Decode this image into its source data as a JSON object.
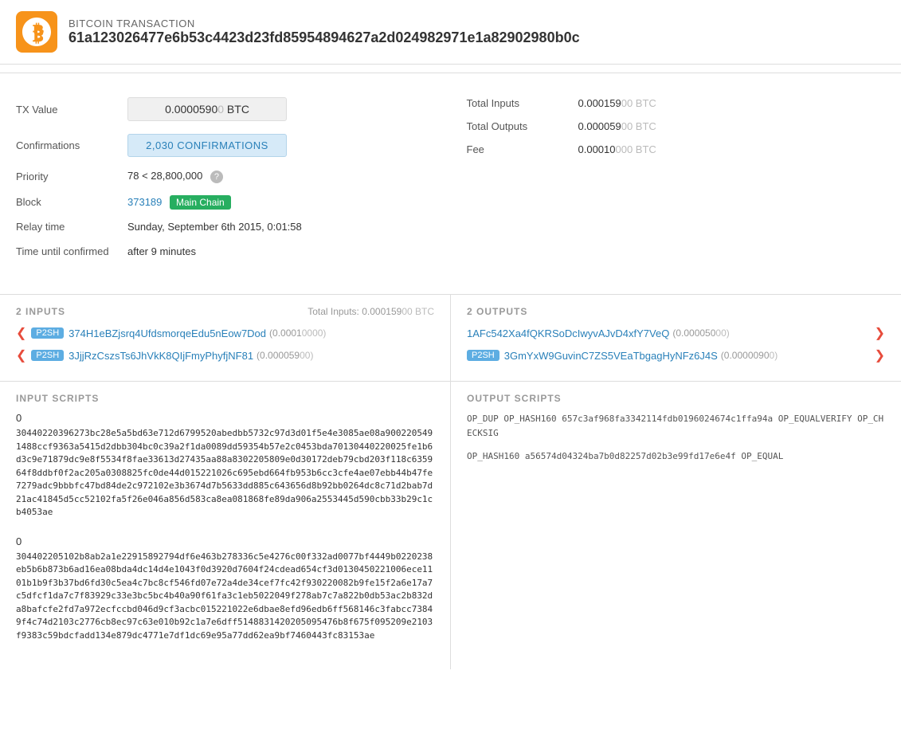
{
  "header": {
    "title": "BITCOIN TRANSACTION",
    "txid": "61a123026477e6b53c4423d23fd85954894627a2d024982971e1a82902980b0c",
    "logo_symbol": "₿"
  },
  "tx_info": {
    "tx_value_label": "TX Value",
    "tx_value": "0.0000590",
    "tx_value_suffix": "0 BTC",
    "tx_value_dim": "0",
    "confirmations_label": "Confirmations",
    "confirmations_text": "2,030 CONFIRMATIONS",
    "priority_label": "Priority",
    "priority_value": "78 < 28,800,000",
    "block_label": "Block",
    "block_number": "373189",
    "block_chain": "Main Chain",
    "relay_time_label": "Relay time",
    "relay_time_value": "Sunday, September 6th 2015, 0:01:58",
    "time_confirmed_label": "Time until confirmed",
    "time_confirmed_value": "after 9 minutes"
  },
  "tx_totals": {
    "total_inputs_label": "Total Inputs",
    "total_inputs_value": "0.000159",
    "total_inputs_dim": "00 BTC",
    "total_outputs_label": "Total Outputs",
    "total_outputs_value": "0.000059",
    "total_outputs_dim": "00 BTC",
    "fee_label": "Fee",
    "fee_value": "0.00010",
    "fee_dim": "000 BTC"
  },
  "inputs_section": {
    "title": "2 INPUTS",
    "subtitle_label": "Total Inputs:",
    "subtitle_value": "0.000159",
    "subtitle_dim": "00 BTC",
    "items": [
      {
        "badge": "P2SH",
        "address": "374H1eBZjsrq4UfdsmorqeEdu5nEow7Dod",
        "amount": "(0.0001",
        "amount_dim": "0000)"
      },
      {
        "badge": "P2SH",
        "address": "3JjjRzCszsTs6JhVkK8QIjFmyPhyfjNF81",
        "amount": "(0.000059",
        "amount_dim": "00)"
      }
    ]
  },
  "outputs_section": {
    "title": "2 OUTPUTS",
    "items": [
      {
        "badge": null,
        "address": "1AFc542Xa4fQKRSoDcIwyvAJvD4xfY7VeQ",
        "amount": "(0.000050",
        "amount_dim": "00)"
      },
      {
        "badge": "P2SH",
        "address": "3GmYxW9GuvinC7ZS5VEaTbgagHyNFz6J4S",
        "amount": "(0.0000090",
        "amount_dim": "0)"
      }
    ]
  },
  "input_scripts": {
    "title": "INPUT SCRIPTS",
    "scripts": [
      {
        "index": "0",
        "text": "30440220396273bc28e5a5bd63e712d6799520abedbb5732c97d3d01f5e4e3085ae08a9002205491488ccf9363a5415d2dbb304bc0c39a2f1da0089dd59354b57e2c0453bda70130440220025fe1b6d3c9e71879dc9e8f5534f8fae33613d27435aa88a8302205809e0d30172deb79cbd203f118c635964f8ddbf0f2ac205a0308825fc0de44d015221026c695ebd664fb953b6cc3cfe4ae07ebb44b47fe7279adc9bbbfc47bd84de2c972102e3b3674d7b5633dd885c643656d8b92bb0264dc8c71d2bab7d21ac41845d5cc52102fa5f26e046a856d583ca8ea081868fe89da906a2553445d590cbb33b29c1cb4053ae"
      },
      {
        "index": "0",
        "text": "304402205102b8ab2a1e22915892794df6e463b278336c5e4276c00f332ad0077bf4449b0220238eb5b6b873b6ad16ea08bda4dc14d4e1043f0d3920d7604f24cdead654cf3d0130450221006ece1101b1b9f3b37bd6fd30c5ea4c7bc8cf546fd07e72a4de34cef7fc42f930220082b9fe15f2a6e17a7c5dfcf1da7c7f83929c33e3bc5bc4b40a90f61fa3c1eb5022049f278ab7c7a822b0db53ac2b832da8bafcfe2fd7a972ecfccbd046d9cf3acbc015221022e6dbae8efd96edb6ff568146c3fabcc73849f4c74d2103c2776cb8ec97c63e010b92c1a7e6dff5148831420205095476b8f675f095209e2103f9383c59bdcfadd134e879dc4771e7df1dc69e95a77dd62ea9bf7460443fc83153ae"
      }
    ]
  },
  "output_scripts": {
    "title": "OUTPUT SCRIPTS",
    "scripts": [
      {
        "text": "OP_DUP OP_HASH160 657c3af968fa3342114fdb0196024674c1ffa94a OP_EQUALVERIFY OP_CHECKSIG"
      },
      {
        "text": "OP_HASH160 a56574d04324ba7b0d82257d02b3e99fd17e6e4f OP_EQUAL"
      }
    ]
  }
}
